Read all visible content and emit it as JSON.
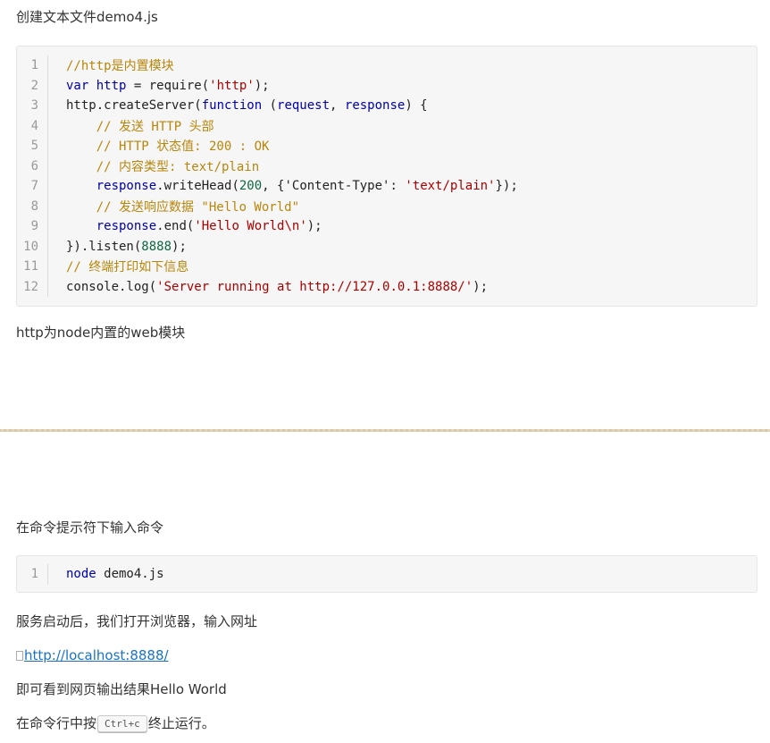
{
  "section1": {
    "intro": "创建文本文件demo4.js",
    "code_lines": [
      {
        "num": "1",
        "tokens": [
          {
            "t": "//http是内置模块",
            "c": "c-com"
          }
        ]
      },
      {
        "num": "2",
        "tokens": [
          {
            "t": "var",
            "c": "c-kw"
          },
          {
            "t": " "
          },
          {
            "t": "http",
            "c": "c-var"
          },
          {
            "t": " = require("
          },
          {
            "t": "'http'",
            "c": "c-str"
          },
          {
            "t": ");"
          }
        ]
      },
      {
        "num": "3",
        "tokens": [
          {
            "t": "http.createServer("
          },
          {
            "t": "function",
            "c": "c-kw"
          },
          {
            "t": " ("
          },
          {
            "t": "request",
            "c": "c-var"
          },
          {
            "t": ", "
          },
          {
            "t": "response",
            "c": "c-var"
          },
          {
            "t": ") {"
          }
        ]
      },
      {
        "num": "4",
        "tokens": [
          {
            "t": "    "
          },
          {
            "t": "// 发送 HTTP 头部",
            "c": "c-com"
          }
        ]
      },
      {
        "num": "5",
        "tokens": [
          {
            "t": "    "
          },
          {
            "t": "// HTTP 状态值: 200 : OK",
            "c": "c-com"
          }
        ]
      },
      {
        "num": "6",
        "tokens": [
          {
            "t": "    "
          },
          {
            "t": "// 内容类型: text/plain",
            "c": "c-com"
          }
        ]
      },
      {
        "num": "7",
        "tokens": [
          {
            "t": "    "
          },
          {
            "t": "response",
            "c": "c-var"
          },
          {
            "t": ".writeHead("
          },
          {
            "t": "200",
            "c": "c-num"
          },
          {
            "t": ", {"
          },
          {
            "t": "'Content-Type'"
          },
          {
            "t": ": "
          },
          {
            "t": "'text/plain'",
            "c": "c-str"
          },
          {
            "t": "});"
          }
        ]
      },
      {
        "num": "8",
        "tokens": [
          {
            "t": "    "
          },
          {
            "t": "// 发送响应数据 \"Hello World\"",
            "c": "c-com"
          }
        ]
      },
      {
        "num": "9",
        "tokens": [
          {
            "t": "    "
          },
          {
            "t": "response",
            "c": "c-var"
          },
          {
            "t": ".end("
          },
          {
            "t": "'Hello World\\n'",
            "c": "c-str"
          },
          {
            "t": ");"
          }
        ]
      },
      {
        "num": "10",
        "tokens": [
          {
            "t": "}).listen("
          },
          {
            "t": "8888",
            "c": "c-num"
          },
          {
            "t": ");"
          }
        ]
      },
      {
        "num": "11",
        "tokens": [
          {
            "t": "// 终端打印如下信息",
            "c": "c-com"
          }
        ]
      },
      {
        "num": "12",
        "tokens": [
          {
            "t": "console.log("
          },
          {
            "t": "'Server running at http://127.0.0.1:8888/'",
            "c": "c-str"
          },
          {
            "t": ");"
          }
        ]
      }
    ],
    "note": "http为node内置的web模块"
  },
  "section2": {
    "intro": "在命令提示符下输入命令",
    "code_lines": [
      {
        "num": "1",
        "tokens": [
          {
            "t": "node",
            "c": "c-kw"
          },
          {
            "t": " demo4.js"
          }
        ]
      }
    ],
    "after_start": "服务启动后，我们打开浏览器，输入网址",
    "url": "http://localhost:8888/",
    "result": "即可看到网页输出结果Hello World",
    "stop_before": "在命令行中按",
    "stop_key": "Ctrl+c",
    "stop_after": "终止运行。"
  }
}
